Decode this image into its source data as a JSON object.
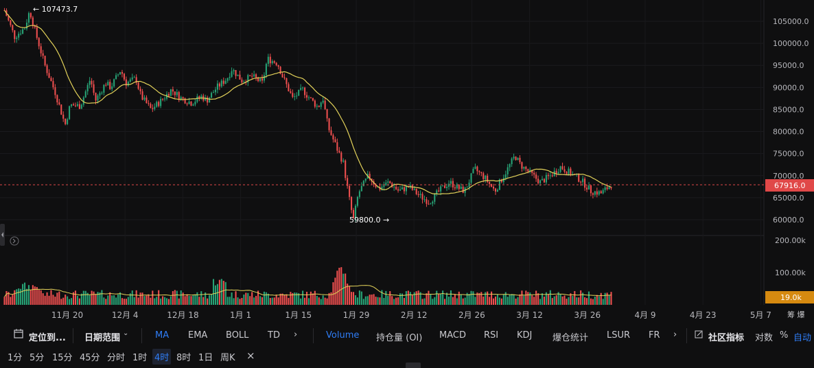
{
  "chart_data": {
    "type": "candlestick",
    "price_ticks": [
      "105000.0",
      "100000.0",
      "95000.0",
      "90000.0",
      "85000.0",
      "80000.0",
      "75000.0",
      "70000.0",
      "65000.0",
      "60000.0"
    ],
    "volume_ticks": [
      "200.00k",
      "100.00k"
    ],
    "x_ticks": [
      "11月 20",
      "12月 4",
      "12月 18",
      "1月 1",
      "1月 15",
      "1月 29",
      "2月 12",
      "2月 26",
      "3月 12",
      "3月 26",
      "4月 9",
      "4月 23",
      "5月 7"
    ],
    "current_price": "67916.0",
    "current_volume": "19.0k",
    "high_label": "← 107473.7",
    "low_label": "59800.0 →",
    "price_range": [
      57000,
      110000
    ],
    "price_path": [
      [
        0,
        107500
      ],
      [
        2,
        101500
      ],
      [
        4,
        103500
      ],
      [
        5,
        107400
      ],
      [
        6,
        103000
      ],
      [
        8,
        95000
      ],
      [
        10,
        89000
      ],
      [
        12,
        81500
      ],
      [
        13,
        86000
      ],
      [
        15,
        85800
      ],
      [
        17,
        92000
      ],
      [
        18,
        87000
      ],
      [
        20,
        91000
      ],
      [
        21,
        90000
      ],
      [
        23,
        94000
      ],
      [
        24,
        91000
      ],
      [
        26,
        92000
      ],
      [
        27,
        88000
      ],
      [
        29,
        85000
      ],
      [
        31,
        87000
      ],
      [
        33,
        89500
      ],
      [
        35,
        87500
      ],
      [
        37,
        86500
      ],
      [
        39,
        88000
      ],
      [
        40,
        87000
      ],
      [
        42,
        90000
      ],
      [
        44,
        92000
      ],
      [
        45,
        94200
      ],
      [
        47,
        91500
      ],
      [
        49,
        92500
      ],
      [
        51,
        91000
      ],
      [
        52,
        96500
      ],
      [
        54,
        95500
      ],
      [
        55,
        92500
      ],
      [
        57,
        87500
      ],
      [
        59,
        89500
      ],
      [
        60,
        88000
      ],
      [
        62,
        85500
      ],
      [
        63,
        87500
      ],
      [
        64,
        81000
      ],
      [
        66,
        75500
      ],
      [
        67,
        73000
      ],
      [
        68,
        66000
      ],
      [
        69,
        59800
      ],
      [
        70,
        66000
      ],
      [
        72,
        70000
      ],
      [
        74,
        67000
      ],
      [
        76,
        68500
      ],
      [
        78,
        66500
      ],
      [
        80,
        67500
      ],
      [
        82,
        65500
      ],
      [
        84,
        64000
      ],
      [
        86,
        66500
      ],
      [
        88,
        68500
      ],
      [
        90,
        67000
      ],
      [
        91,
        66500
      ],
      [
        93,
        71500
      ],
      [
        95,
        69500
      ],
      [
        97,
        66500
      ],
      [
        99,
        70500
      ],
      [
        101,
        74500
      ],
      [
        102,
        72500
      ],
      [
        104,
        70500
      ],
      [
        106,
        68500
      ],
      [
        108,
        70000
      ],
      [
        110,
        72000
      ],
      [
        112,
        70500
      ],
      [
        114,
        69000
      ],
      [
        116,
        66500
      ],
      [
        118,
        66000
      ],
      [
        119,
        67000
      ],
      [
        120,
        67900
      ]
    ],
    "ma_smooth": 6
  },
  "toolbar": {
    "goto_label": "定位到...",
    "date_range_label": "日期范围",
    "ma": "MA",
    "ema": "EMA",
    "boll": "BOLL",
    "td": "TD",
    "volume": "Volume",
    "oi": "持仓量 (OI)",
    "macd": "MACD",
    "rsi": "RSI",
    "kdj": "KDJ",
    "liq": "爆仓统计",
    "lsur": "LSUR",
    "fr": "FR",
    "community": "社区指标",
    "log": "对数",
    "pct": "%",
    "auto": "自动"
  },
  "timeframes": [
    "1分",
    "5分",
    "15分",
    "45分",
    "分时",
    "1时",
    "4时",
    "8时",
    "1日",
    "周K"
  ],
  "active_timeframe": "4时",
  "top_right_text": "筹 爆",
  "colors": {
    "up": "#27a376",
    "down": "#ef4f4f",
    "ma": "#e3d25a",
    "current": "#e04848",
    "volume_badge": "#d68a10",
    "active": "#2f7df6"
  }
}
